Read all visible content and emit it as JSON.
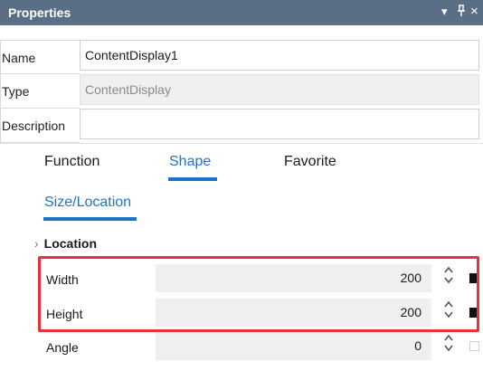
{
  "panel": {
    "title": "Properties",
    "controls": [
      "▾",
      "ᵖ",
      "×"
    ]
  },
  "props": {
    "name": {
      "label": "Name",
      "value": "ContentDisplay1"
    },
    "type": {
      "label": "Type",
      "value": "ContentDisplay"
    },
    "description": {
      "label": "Description",
      "value": ""
    }
  },
  "tabs": [
    {
      "label": "Function",
      "active": false
    },
    {
      "label": "Shape",
      "active": true
    },
    {
      "label": "Favorite",
      "active": false
    }
  ],
  "subtab": {
    "label": "Size/Location"
  },
  "section": {
    "label": "Location",
    "chevron": "›"
  },
  "rows": [
    {
      "label": "Width",
      "value": "200",
      "swatch": "filled"
    },
    {
      "label": "Height",
      "value": "200",
      "swatch": "filled"
    },
    {
      "label": "Angle",
      "value": "0",
      "swatch": "empty"
    }
  ],
  "icons": {
    "spin": "spinner-up-down-icon"
  },
  "colors": {
    "accent": "#1f73c6",
    "highlight": "#e8313e",
    "titlebar": "#5a6f86"
  }
}
